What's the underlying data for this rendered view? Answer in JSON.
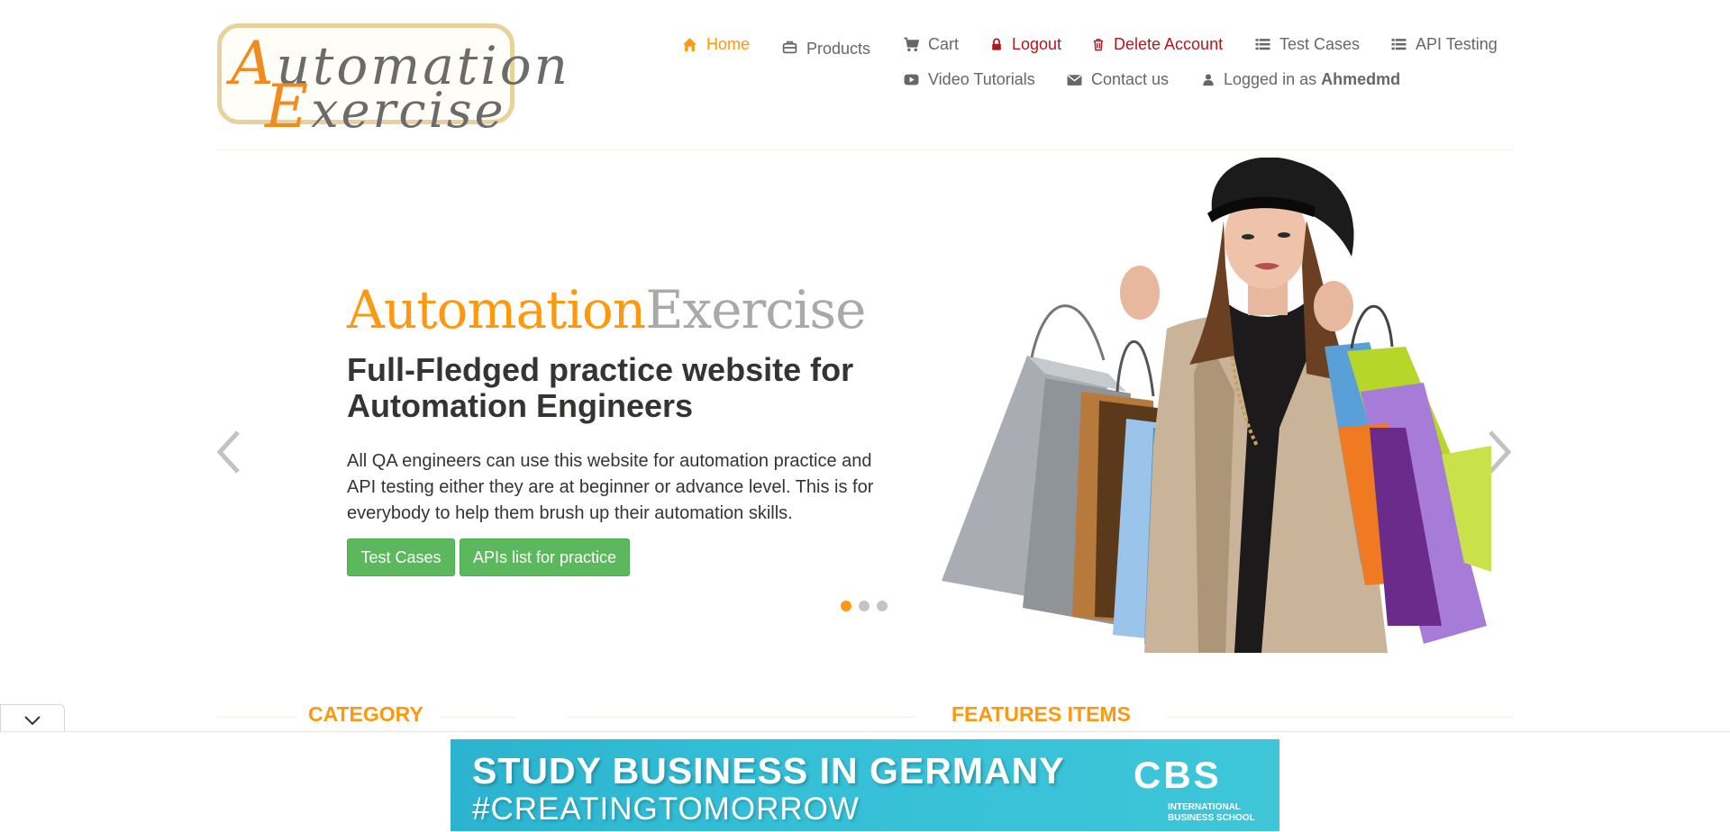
{
  "logo": {
    "line1_first": "A",
    "line1_rest": "utomation",
    "line2_first": "E",
    "line2_rest": "xercise"
  },
  "nav": {
    "home": "Home",
    "products": "Products",
    "cart": "Cart",
    "logout": "Logout",
    "delete_account": "Delete Account",
    "test_cases": "Test Cases",
    "api_testing": "API Testing",
    "video_tutorials": "Video Tutorials",
    "contact_us": "Contact us",
    "logged_in_prefix": "Logged in as",
    "username": "Ahmedmd"
  },
  "hero": {
    "brand_part1": "Automation",
    "brand_part2": "Exercise",
    "title": "Full-Fledged practice website for Automation Engineers",
    "text": "All QA engineers can use this website for automation practice and API testing either they are at beginner or advance level. This is for everybody to help them brush up their automation skills.",
    "btn_test_cases": "Test Cases",
    "btn_apis": "APIs list for practice",
    "active_slide": 1,
    "slide_count": 3
  },
  "sections": {
    "category": "Category",
    "features": "Features Items"
  },
  "ad": {
    "line1": "STUDY BUSINESS IN GERMANY",
    "line2": "#CREATINGTOMORROW",
    "logo": "CBS",
    "logo_sub": "INTERNATIONAL BUSINESS SCHOOL"
  },
  "colors": {
    "accent": "#fe980f",
    "danger": "#b4171b",
    "button": "#5cb85c",
    "ad_bg": "#35bfd7"
  },
  "icons": [
    "home-icon",
    "briefcase-icon",
    "cart-icon",
    "lock-icon",
    "trash-icon",
    "list-icon",
    "youtube-icon",
    "envelope-icon",
    "user-icon",
    "chevron-left-icon",
    "chevron-right-icon",
    "chevron-down-icon"
  ]
}
